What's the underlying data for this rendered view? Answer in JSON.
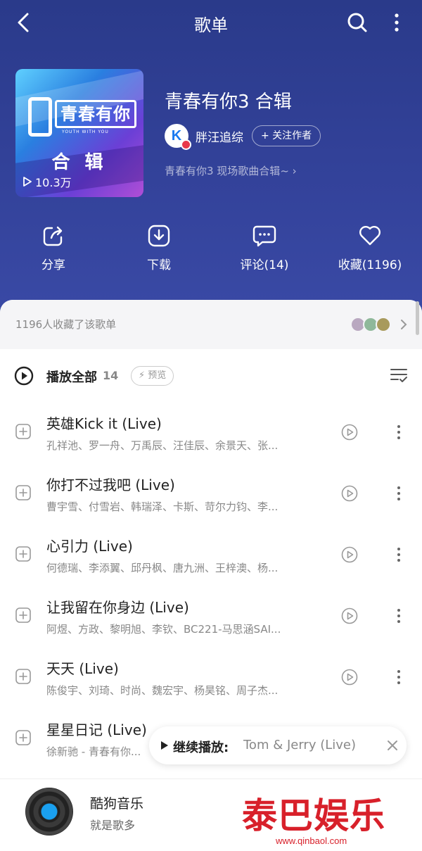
{
  "nav": {
    "title": "歌单"
  },
  "cover": {
    "brand": "青春有你",
    "brand_sub": "YOUTH WITH YOU",
    "subtitle": "合 辑",
    "plays": "10.3万"
  },
  "playlist": {
    "title": "青春有你3 合辑",
    "author_initial": "K",
    "author": "胖汪追综",
    "follow_label": "+ 关注作者",
    "description": "青春有你3 现场歌曲合辑~ ›"
  },
  "actions": [
    {
      "label": "分享",
      "icon": "share-icon"
    },
    {
      "label": "下载",
      "icon": "download-icon"
    },
    {
      "label": "评论(14)",
      "icon": "comment-icon"
    },
    {
      "label": "收藏(1196)",
      "icon": "heart-icon"
    }
  ],
  "collectors": {
    "text": "1196人收藏了该歌单"
  },
  "play_all": {
    "label": "播放全部",
    "count": "14",
    "preview_label": "预览"
  },
  "songs": [
    {
      "title": "英雄Kick it (Live)",
      "artists": "孔祥池、罗一舟、万禹辰、汪佳辰、余景天、张..."
    },
    {
      "title": "你打不过我吧 (Live)",
      "artists": "曹宇雪、付雪岩、韩瑞泽、卡斯、苛尔力钧、李..."
    },
    {
      "title": "心引力 (Live)",
      "artists": "何德瑞、李添翼、邱丹枫、唐九洲、王梓澳、杨..."
    },
    {
      "title": "让我留在你身边 (Live)",
      "artists": "阿煜、方政、黎明旭、李钦、BC221-马思涵SAI..."
    },
    {
      "title": "天天 (Live)",
      "artists": "陈俊宇、刘琦、时尚、魏宏宇、杨昊铭、周子杰..."
    },
    {
      "title": "星星日记 (Live)",
      "artists": "徐新驰 - 青春有你..."
    }
  ],
  "resume": {
    "label": "继续播放:",
    "song": "Tom & Jerry (Live)"
  },
  "footer": {
    "app_name": "酷狗音乐",
    "slogan": "就是歌多"
  },
  "watermark": {
    "logo": "泰巴娱乐",
    "url": "www.qinbaol.com"
  },
  "colors": {
    "header": "#33429a",
    "accent": "#1aa0f0",
    "watermark": "#d8202a"
  }
}
